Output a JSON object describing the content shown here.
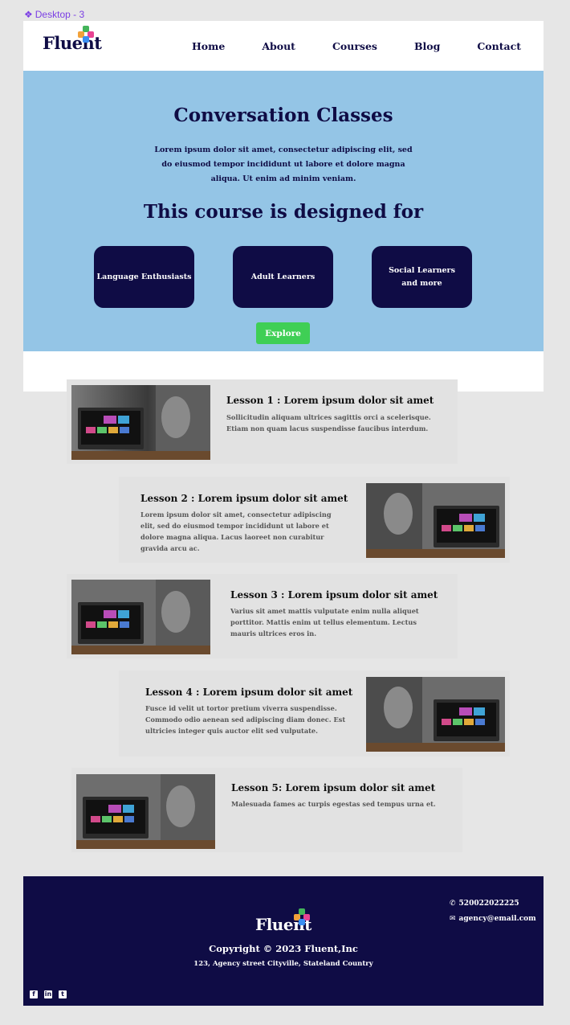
{
  "frame": {
    "label": "Desktop - 3",
    "icon": "component-diamond-icon"
  },
  "header": {
    "logo": "Fluent",
    "nav": [
      "Home",
      "About",
      "Courses",
      "Blog",
      "Contact"
    ]
  },
  "hero": {
    "title": "Conversation Classes",
    "intro": "Lorem ipsum dolor sit amet, consectetur adipiscing elit, sed do eiusmod tempor incididunt ut labore et dolore magna aliqua. Ut enim ad minim veniam.",
    "subtitle": "This course is designed for",
    "audiences": [
      "Language Enthusiasts",
      "Adult Learners",
      "Social Learners and more"
    ],
    "cta": "Explore"
  },
  "lessons": [
    {
      "title": "Lesson 1 : Lorem ipsum dolor sit amet",
      "text": "Sollicitudin aliquam ultrices sagittis orci a scelerisque. Etiam non quam lacus suspendisse faucibus interdum."
    },
    {
      "title": "Lesson 2 : Lorem ipsum dolor sit amet",
      "text": "Lorem ipsum dolor sit amet, consectetur adipiscing elit, sed do eiusmod tempor incididunt ut labore et dolore magna aliqua. Lacus laoreet non curabitur gravida arcu ac."
    },
    {
      "title": "Lesson 3 : Lorem ipsum dolor sit amet",
      "text": "Varius sit amet mattis vulputate enim nulla aliquet porttitor. Mattis enim ut tellus elementum. Lectus mauris ultrices eros in."
    },
    {
      "title": "Lesson 4 : Lorem ipsum dolor sit amet",
      "text": "Fusce id velit ut tortor pretium viverra suspendisse. Commodo odio aenean sed adipiscing diam donec. Est ultricies integer quis auctor elit sed vulputate."
    },
    {
      "title": "Lesson 5: Lorem ipsum dolor sit amet",
      "text": "Malesuada fames ac turpis egestas sed tempus urna et."
    }
  ],
  "footer": {
    "logo": "Fluent",
    "copyright": "Copyright © 2023 Fluent,Inc",
    "address": "123, Agency street Cityville, Stateland Country",
    "phone": "520022022225",
    "email": "agency@email.com",
    "social": [
      "facebook-icon",
      "linkedin-icon",
      "twitter-icon"
    ]
  },
  "colors": {
    "navy": "#0f0c45",
    "hero_bg": "#94c5e6",
    "cta_green": "#3fcf55",
    "lesson_bg": "#e2e2e2"
  }
}
